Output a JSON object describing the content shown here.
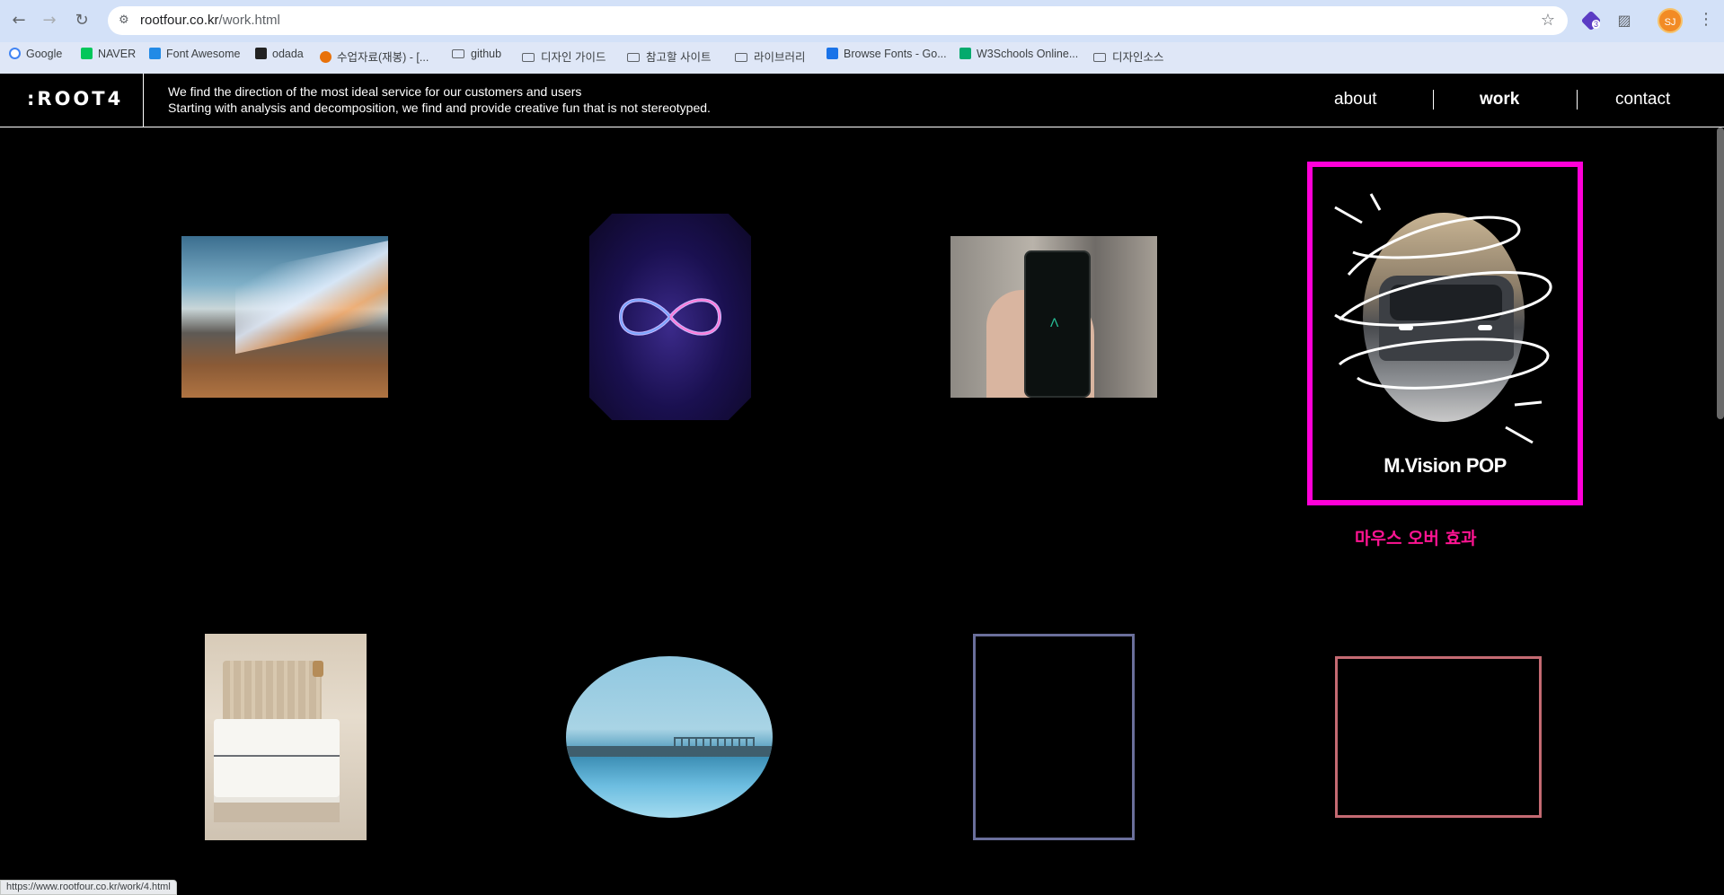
{
  "browser": {
    "url_host": "rootfour.co.kr",
    "url_path": "/work.html",
    "profile_initials": "SJ",
    "extension_badge": "3",
    "bookmarks": [
      {
        "label": "Google",
        "color": "#4285f4"
      },
      {
        "label": "NAVER",
        "color": "#03c75a"
      },
      {
        "label": "Font Awesome",
        "color": "#228ae6"
      },
      {
        "label": "odada",
        "color": "#222222"
      },
      {
        "label": "수업자료(재봉) - [...",
        "color": "#e8710a"
      },
      {
        "label": "github",
        "folder": true
      },
      {
        "label": "디자인 가이드",
        "folder": true
      },
      {
        "label": "참고할 사이트",
        "folder": true
      },
      {
        "label": "라이브러리",
        "folder": true
      },
      {
        "label": "Browse Fonts - Go...",
        "color": "#1a73e8"
      },
      {
        "label": "W3Schools Online...",
        "color": "#04aa6d"
      },
      {
        "label": "디자인소스",
        "folder": true
      }
    ],
    "status_url": "https://www.rootfour.co.kr/work/4.html"
  },
  "site": {
    "logo": ":ROOT4",
    "tagline_line1": "We find the direction of the most ideal service for our customers and users",
    "tagline_line2": "Starting with analysis and decomposition, we find and provide creative fun that is not stereotyped.",
    "nav": [
      {
        "label": "about",
        "active": false
      },
      {
        "label": "work",
        "active": true
      },
      {
        "label": "contact",
        "active": false
      }
    ]
  },
  "work": {
    "hover_item_title": "M.Vision POP",
    "hover_note": "마우스 오버 효과",
    "accent_hover_frame": "#ff00d8",
    "accent_note": "#ff1493",
    "outline_tile_7": "#6a6f9b",
    "outline_tile_8": "#c46a72"
  }
}
